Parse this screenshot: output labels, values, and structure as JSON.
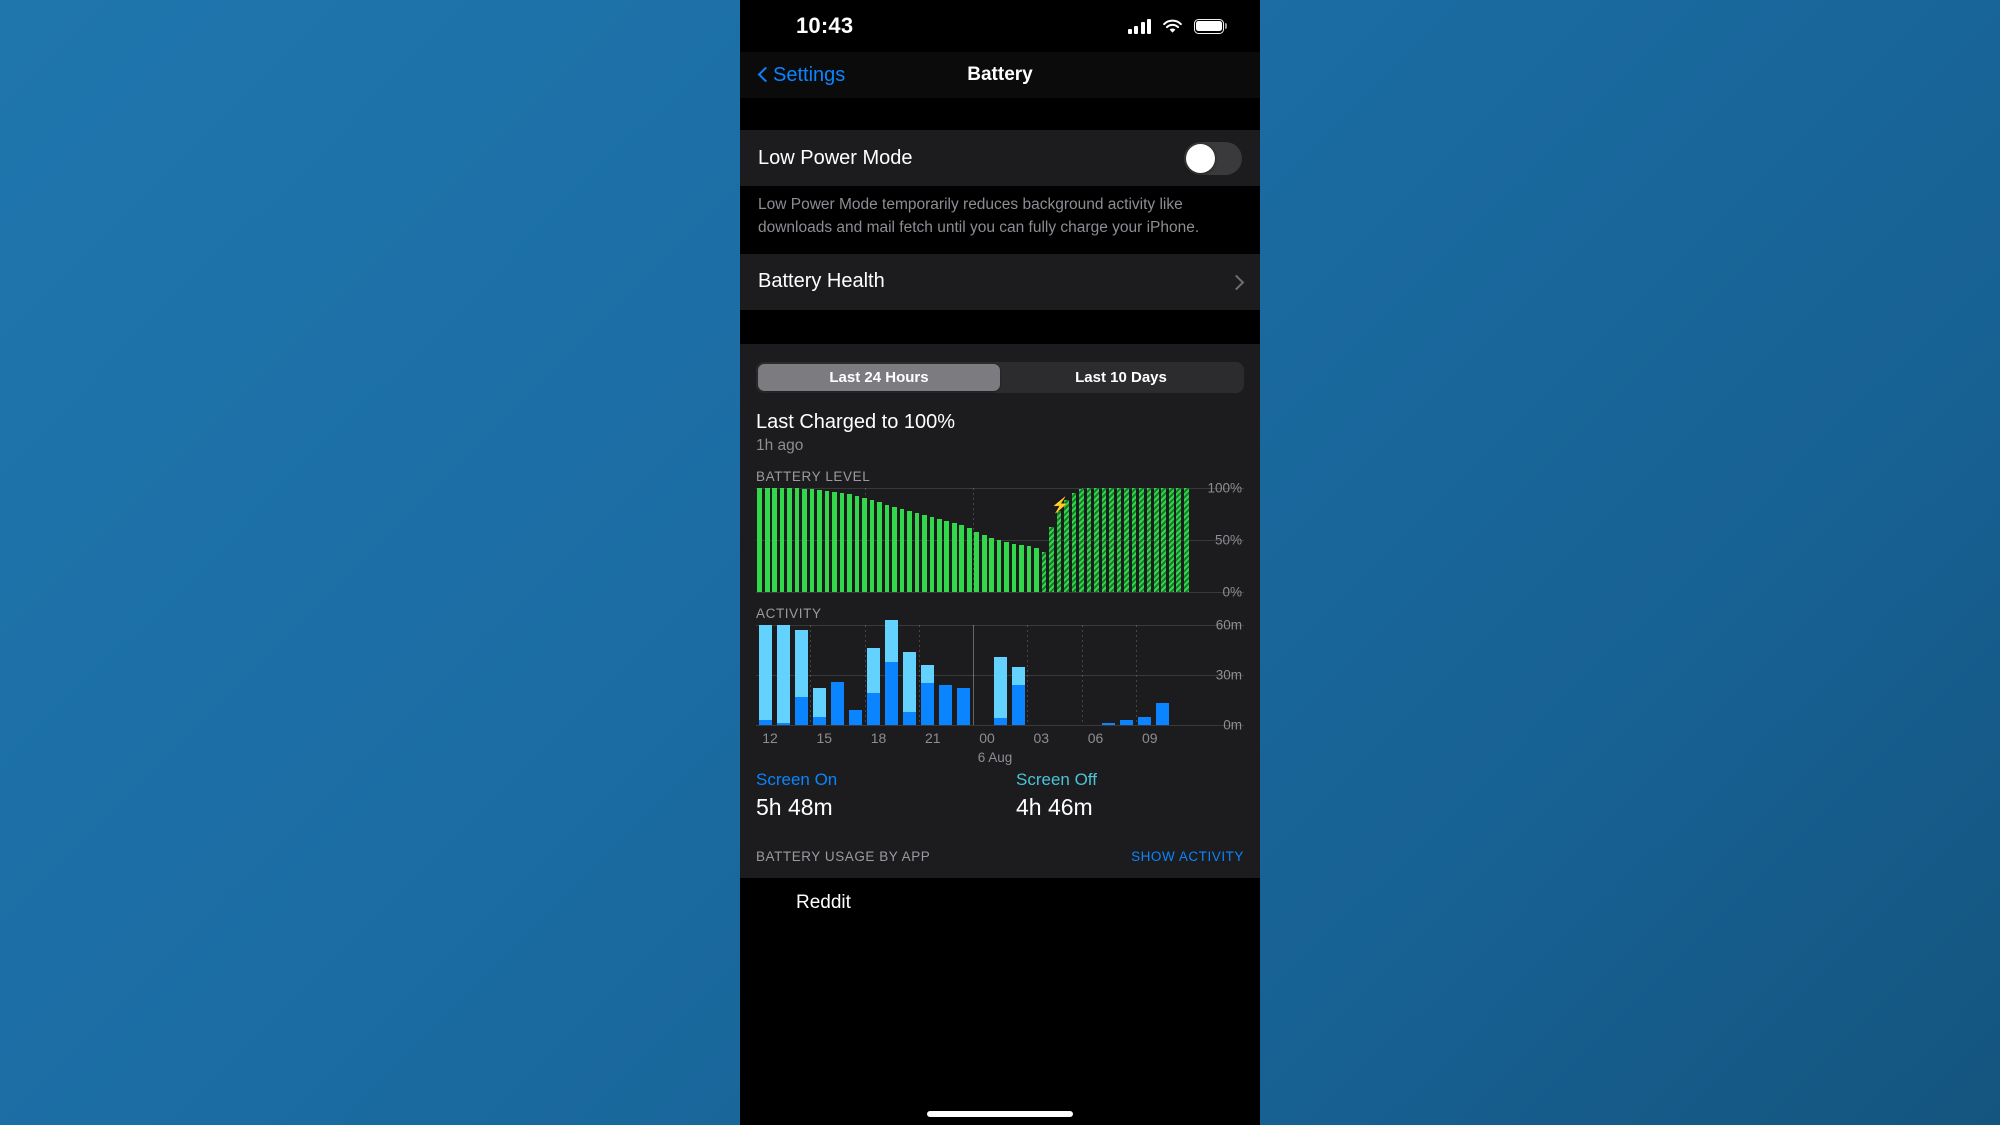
{
  "status_bar": {
    "time": "10:43",
    "icons": [
      "cellular-signal-icon",
      "wifi-icon",
      "battery-icon"
    ]
  },
  "nav": {
    "back_label": "Settings",
    "title": "Battery"
  },
  "low_power": {
    "label": "Low Power Mode",
    "toggle_state": "off",
    "description": "Low Power Mode temporarily reduces background activity like downloads and mail fetch until you can fully charge your iPhone."
  },
  "battery_health": {
    "label": "Battery Health"
  },
  "segmented": {
    "options": [
      "Last 24 Hours",
      "Last 10 Days"
    ],
    "selected": "Last 24 Hours"
  },
  "charged": {
    "title": "Last Charged to 100%",
    "subtitle": "1h ago"
  },
  "totals": {
    "screen_on_label": "Screen On",
    "screen_on_value": "5h 48m",
    "screen_off_label": "Screen Off",
    "screen_off_value": "4h 46m"
  },
  "usage_section": {
    "header": "BATTERY USAGE BY APP",
    "action": "SHOW ACTIVITY",
    "first_app": "Reddit"
  },
  "colors": {
    "accent_blue": "#0a84ff",
    "battery_green": "#32d74b",
    "screen_on_blue": "#64d2ff",
    "screen_off_blue": "#0a84ff",
    "screen_off_teal": "#4cc2d6",
    "desktop_blue": "#1b6da4"
  },
  "chart_data": [
    {
      "type": "area",
      "name": "battery-level-chart",
      "title": "BATTERY LEVEL",
      "xlabel": "",
      "ylabel": "",
      "ylim": [
        0,
        100
      ],
      "ytick_labels": [
        "100%",
        "50%",
        "0%"
      ],
      "ytick_values": [
        100,
        50,
        0
      ],
      "grid": true,
      "charging_start_index": 38,
      "bolt_marker_index": 40,
      "values": [
        100,
        100,
        100,
        100,
        100,
        100,
        99,
        99,
        98,
        97,
        96,
        95,
        94,
        92,
        90,
        88,
        86,
        84,
        82,
        80,
        78,
        76,
        74,
        72,
        70,
        68,
        66,
        64,
        61,
        58,
        55,
        52,
        50,
        48,
        46,
        45,
        44,
        42,
        38,
        62,
        78,
        88,
        95,
        99,
        100,
        100,
        100,
        100,
        100,
        100,
        100,
        100,
        100,
        100,
        100,
        100,
        100,
        100
      ]
    },
    {
      "type": "bar",
      "name": "activity-chart",
      "title": "ACTIVITY",
      "xlabel": "",
      "ylabel": "",
      "ylim": [
        0,
        60
      ],
      "ytick_labels": [
        "60m",
        "30m",
        "0m"
      ],
      "ytick_values": [
        60,
        30,
        0
      ],
      "xtick_labels": [
        "12",
        "15",
        "18",
        "21",
        "00",
        "03",
        "06",
        "09"
      ],
      "xtick_sublabel": "6 Aug",
      "xtick_sublabel_at": "00",
      "grid": true,
      "stacked": true,
      "series": [
        {
          "name": "Screen On",
          "color": "#64d2ff",
          "values": [
            57,
            59,
            40,
            17,
            0,
            0,
            27,
            25,
            36,
            11,
            0,
            0,
            0,
            37,
            11,
            0,
            0,
            0,
            0,
            0,
            0,
            0,
            0,
            0
          ]
        },
        {
          "name": "Screen Off",
          "color": "#0a84ff",
          "values": [
            3,
            1,
            17,
            5,
            26,
            9,
            19,
            38,
            8,
            25,
            24,
            22,
            0,
            4,
            24,
            0,
            0,
            0,
            0,
            1,
            3,
            5,
            13,
            0
          ]
        }
      ]
    }
  ]
}
